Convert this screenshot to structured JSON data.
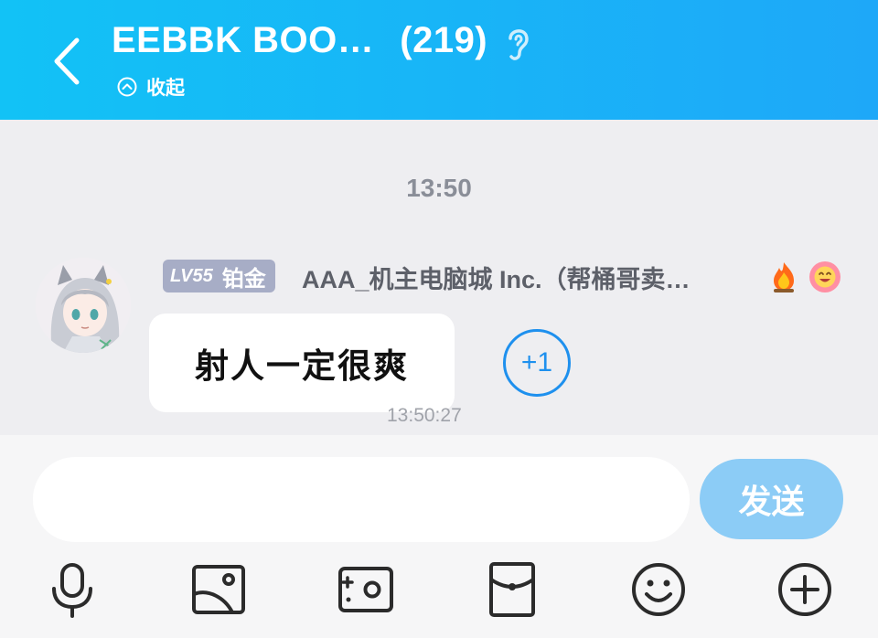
{
  "header": {
    "title": "EEBBK BOO…",
    "member_count": "(219)",
    "collapse_label": "收起",
    "background_color": "#12c2f6"
  },
  "chat": {
    "time_divider": "13:50",
    "message": {
      "level": "LV55",
      "rank": "铂金",
      "sender": "AAA_机主电脑城 Inc.（帮桶哥卖…",
      "text": "射人一定很爽",
      "plus_one": "+1",
      "timestamp": "13:50:27"
    }
  },
  "composer": {
    "input_value": "",
    "send_label": "发送",
    "send_color": "#8cccf6"
  },
  "toolbar": {
    "icons": [
      "microphone-icon",
      "image-icon",
      "camera-icon",
      "red-packet-icon",
      "smiley-icon",
      "plus-icon"
    ]
  }
}
